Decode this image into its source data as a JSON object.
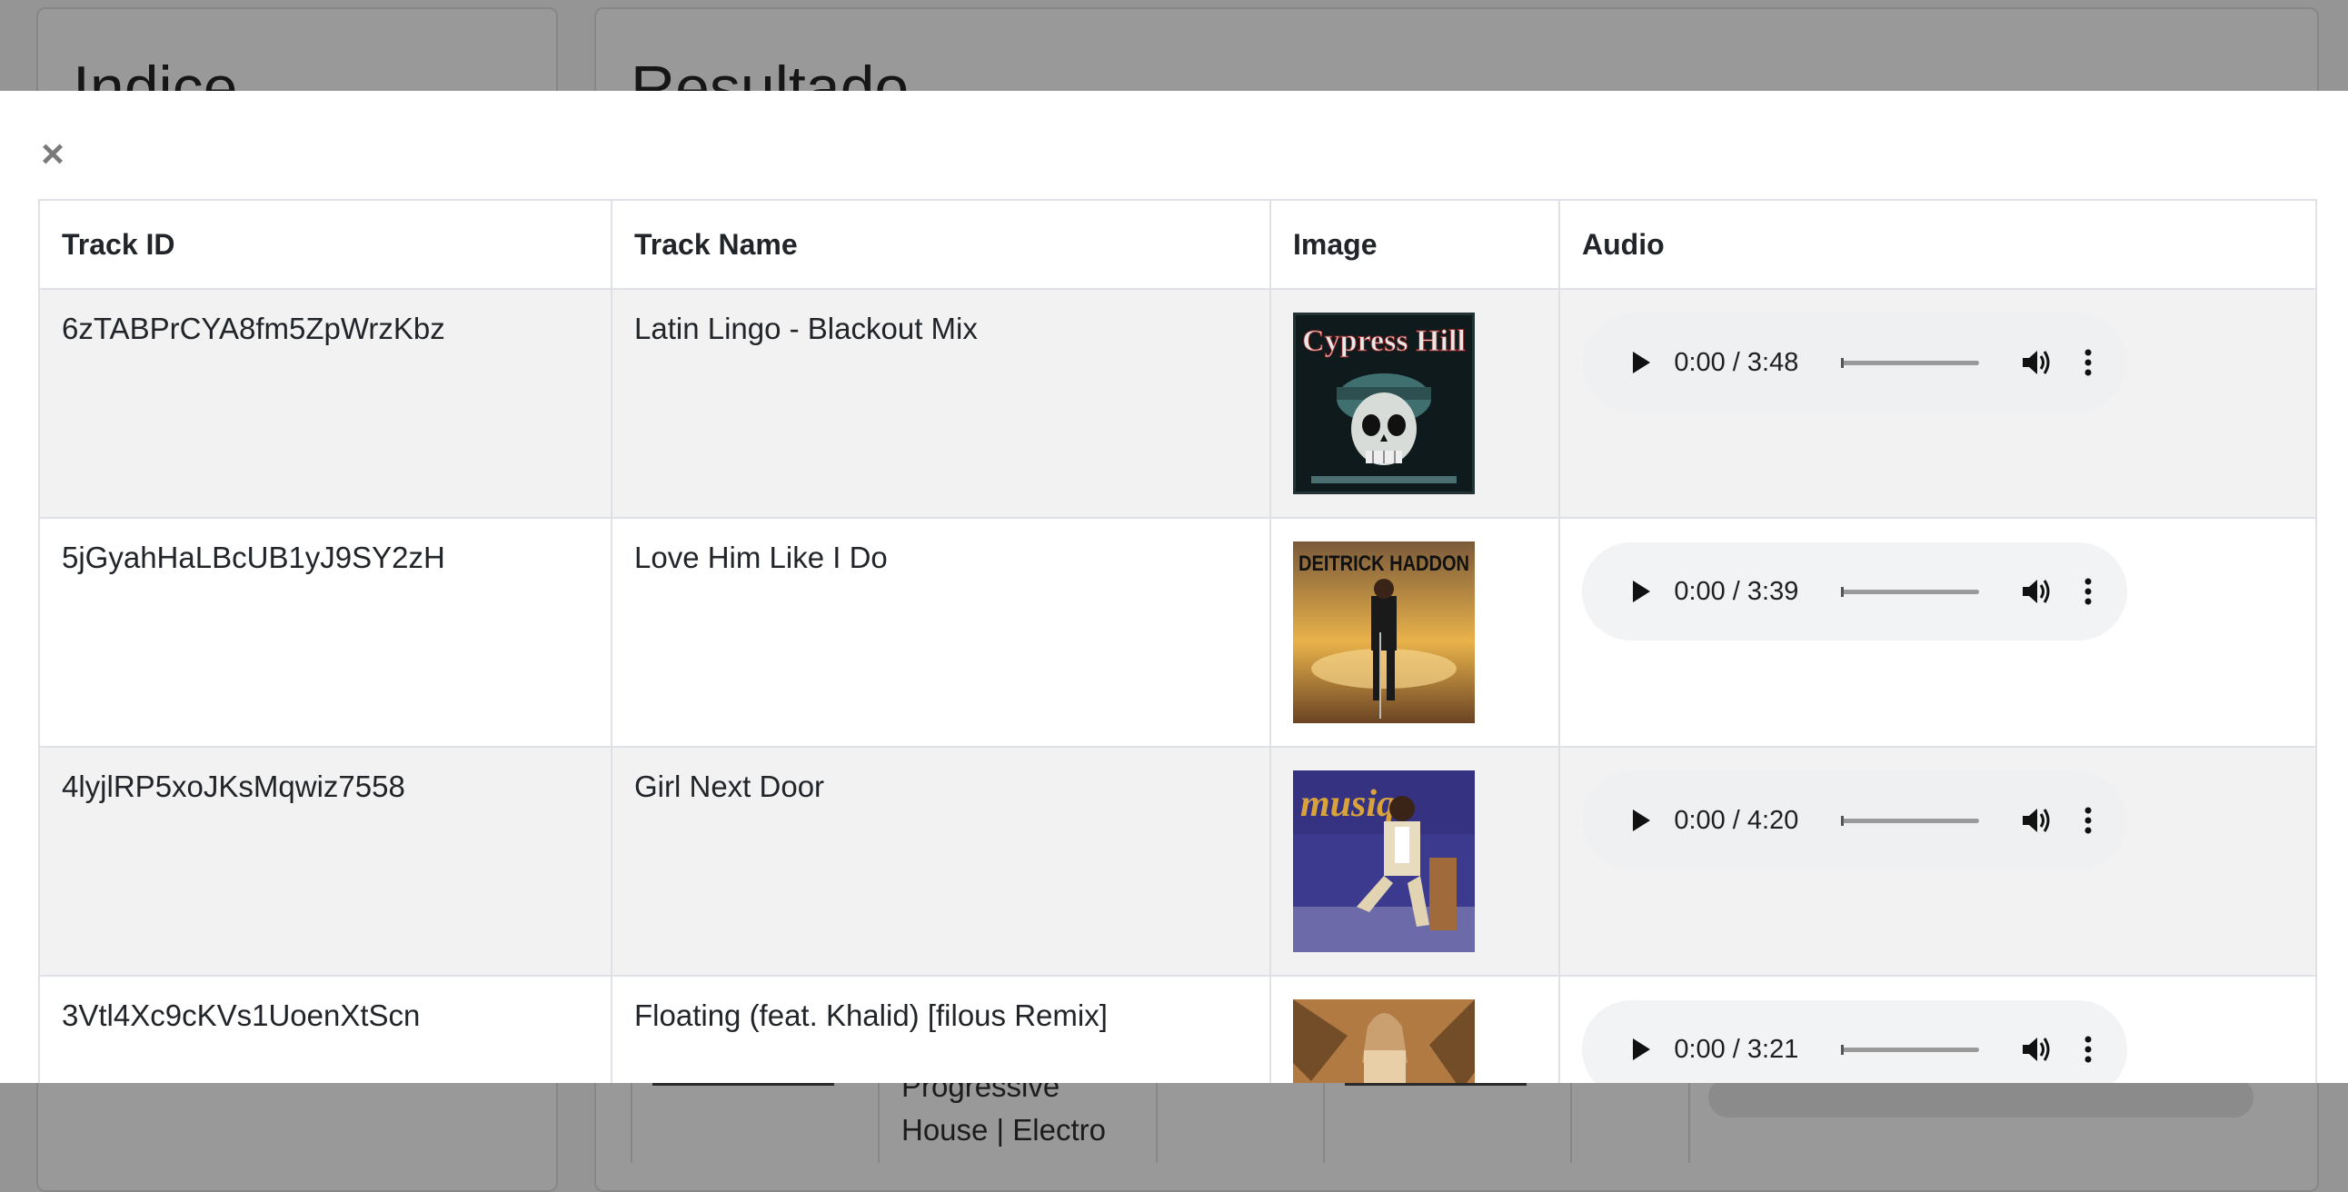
{
  "background": {
    "left_panel_title": "Indice",
    "right_panel_title": "Resultado",
    "peek_genre_lines": [
      "Progressive",
      "House | Electro"
    ]
  },
  "modal": {
    "close_label": "×",
    "columns": [
      "Track ID",
      "Track Name",
      "Image",
      "Audio"
    ],
    "rows": [
      {
        "track_id": "6zTABPrCYA8fm5ZpWrzKbz",
        "track_name": "Latin Lingo - Blackout Mix",
        "image_alt": "Cypress Hill album cover",
        "audio_time": "0:00 / 3:48"
      },
      {
        "track_id": "5jGyahHaLBcUB1yJ9SY2zH",
        "track_name": "Love Him Like I Do",
        "image_alt": "Deitrick Haddon album cover",
        "audio_time": "0:00 / 3:39"
      },
      {
        "track_id": "4lyjlRP5xoJKsMqwiz7558",
        "track_name": "Girl Next Door",
        "image_alt": "Musiq album cover",
        "audio_time": "0:00 / 4:20"
      },
      {
        "track_id": "3Vtl4Xc9cKVs1UoenXtScn",
        "track_name": "Floating (feat. Khalid) [filous Remix]",
        "image_alt": "Floating single cover",
        "audio_time": "0:00 / 3:21"
      }
    ]
  },
  "cover_art": {
    "cypress_text": "Cypress Hill",
    "haddon_text": "DEITRICK HADDON",
    "musiq_text": "musiq"
  }
}
